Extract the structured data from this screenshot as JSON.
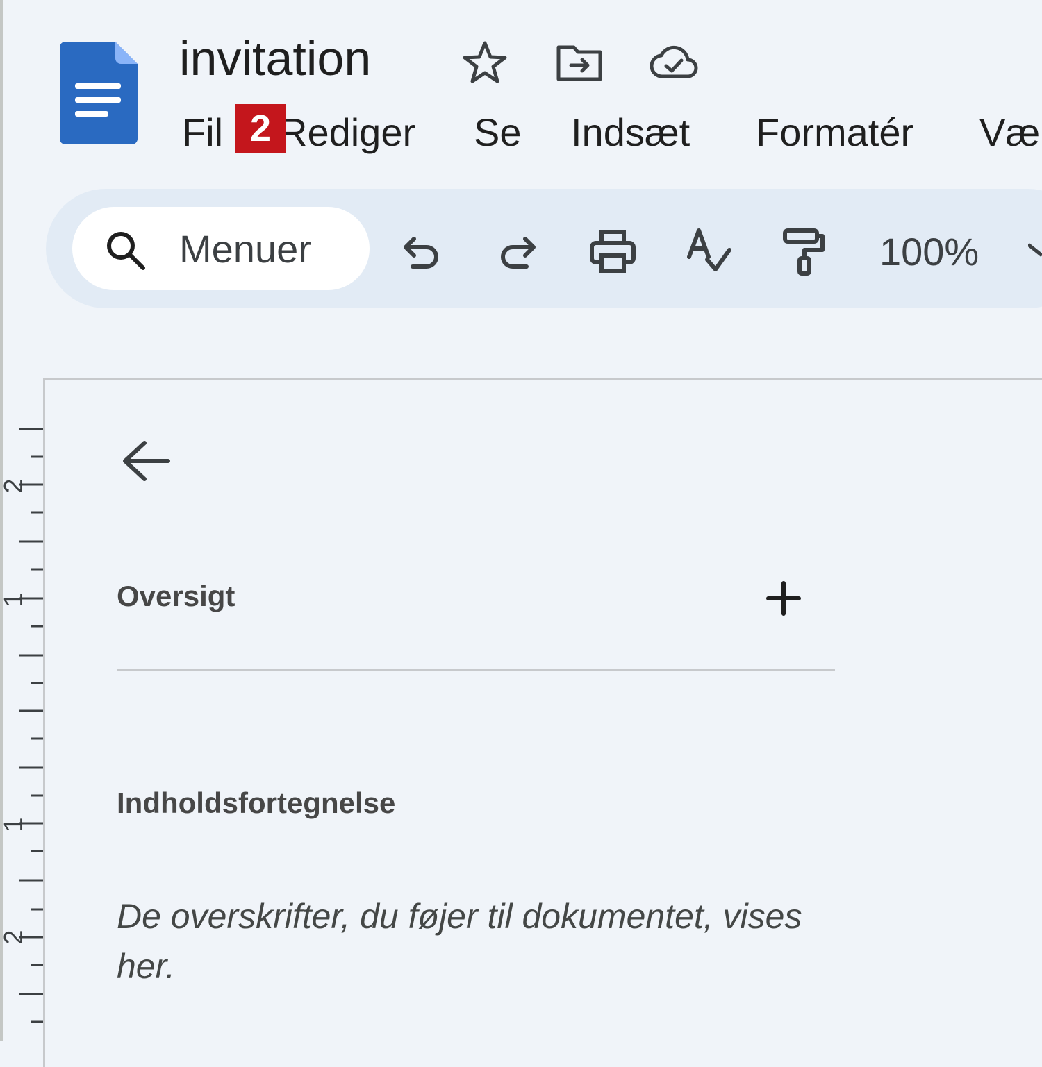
{
  "app": {
    "logo_icon": "google-docs-icon",
    "accent_color": "#2a6ac1"
  },
  "document": {
    "title": "invitation",
    "title_icons": [
      "star-icon",
      "move-to-folder-icon",
      "cloud-saved-icon"
    ]
  },
  "menu": {
    "items": [
      {
        "label": "Fil"
      },
      {
        "label": "Rediger"
      },
      {
        "label": "Se"
      },
      {
        "label": "Indsæt"
      },
      {
        "label": "Formatér"
      },
      {
        "label": "Væ"
      }
    ],
    "hint_badge": "2",
    "hint_badge_color": "#c4161c"
  },
  "toolbar": {
    "search_label": "Menuer",
    "tools": [
      "undo-icon",
      "redo-icon",
      "print-icon",
      "spellcheck-icon",
      "paint-format-icon"
    ],
    "zoom": "100%"
  },
  "ruler": {
    "labels": [
      "2",
      "1",
      "1",
      "2"
    ]
  },
  "outline_panel": {
    "heading": "Oversigt",
    "toc_heading": "Indholdsfortegnelse",
    "placeholder": "De overskrifter, du føjer til dokumentet, vises her."
  }
}
